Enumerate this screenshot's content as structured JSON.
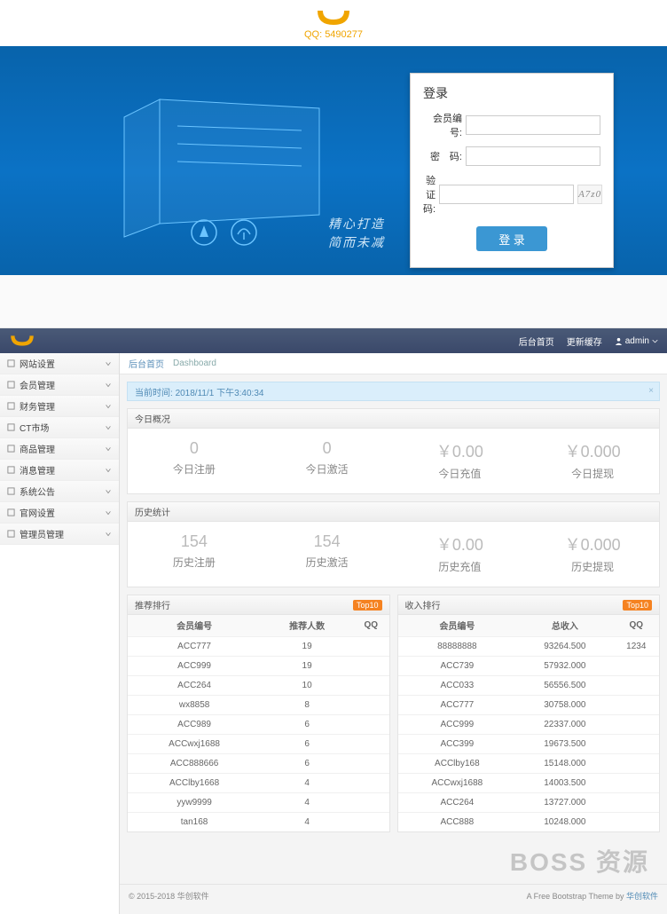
{
  "logo_sub": "QQ: 5490277",
  "hero_tag_1": "精心打造",
  "hero_tag_2": "简而未减",
  "login": {
    "title": "登录",
    "user_label": "会员编号:",
    "pwd_label": "密　码:",
    "captcha_label": "验证码:",
    "captcha_text": "A7z0",
    "button": "登 录"
  },
  "admin": {
    "nav_home": "后台首页",
    "nav_cache": "更新缓存",
    "nav_user": "admin",
    "crumb_home": "后台首页",
    "crumb_page": "Dashboard",
    "time_prefix": "当前时间:",
    "time_value": "2018/11/1 下午3:40:34",
    "sidebar": [
      "网站设置",
      "会员管理",
      "财务管理",
      "CT市场",
      "商品管理",
      "消息管理",
      "系统公告",
      "官网设置",
      "管理员管理"
    ],
    "today_title": "今日概况",
    "today": [
      {
        "num": "0",
        "lab": "今日注册"
      },
      {
        "num": "0",
        "lab": "今日激活"
      },
      {
        "num": "￥0.00",
        "lab": "今日充值"
      },
      {
        "num": "￥0.000",
        "lab": "今日提现"
      }
    ],
    "history_title": "历史统计",
    "history": [
      {
        "num": "154",
        "lab": "历史注册"
      },
      {
        "num": "154",
        "lab": "历史激活"
      },
      {
        "num": "￥0.00",
        "lab": "历史充值"
      },
      {
        "num": "￥0.000",
        "lab": "历史提现"
      }
    ],
    "rec_title": "推荐排行",
    "rec_badge": "Top10",
    "rec_cols": [
      "会员编号",
      "推荐人数",
      "QQ"
    ],
    "rec_rows": [
      [
        "ACC777",
        "19",
        ""
      ],
      [
        "ACC999",
        "19",
        ""
      ],
      [
        "ACC264",
        "10",
        ""
      ],
      [
        "wx8858",
        "8",
        ""
      ],
      [
        "ACC989",
        "6",
        ""
      ],
      [
        "ACCwxj1688",
        "6",
        ""
      ],
      [
        "ACC888666",
        "6",
        ""
      ],
      [
        "ACClby1668",
        "4",
        ""
      ],
      [
        "yyw9999",
        "4",
        ""
      ],
      [
        "tan168",
        "4",
        ""
      ]
    ],
    "inc_title": "收入排行",
    "inc_badge": "Top10",
    "inc_cols": [
      "会员编号",
      "总收入",
      "QQ"
    ],
    "inc_rows": [
      [
        "88888888",
        "93264.500",
        "1234"
      ],
      [
        "ACC739",
        "57932.000",
        ""
      ],
      [
        "ACC033",
        "56556.500",
        ""
      ],
      [
        "ACC777",
        "30758.000",
        ""
      ],
      [
        "ACC999",
        "22337.000",
        ""
      ],
      [
        "ACC399",
        "19673.500",
        ""
      ],
      [
        "ACClby168",
        "15148.000",
        ""
      ],
      [
        "ACCwxj1688",
        "14003.500",
        ""
      ],
      [
        "ACC264",
        "13727.000",
        ""
      ],
      [
        "ACC888",
        "10248.000",
        ""
      ]
    ],
    "watermark": "BOSS 资源",
    "footer_left": "© 2015-2018 华创软件",
    "footer_right_1": "A Free Bootstrap Theme by ",
    "footer_right_2": "华创软件"
  }
}
